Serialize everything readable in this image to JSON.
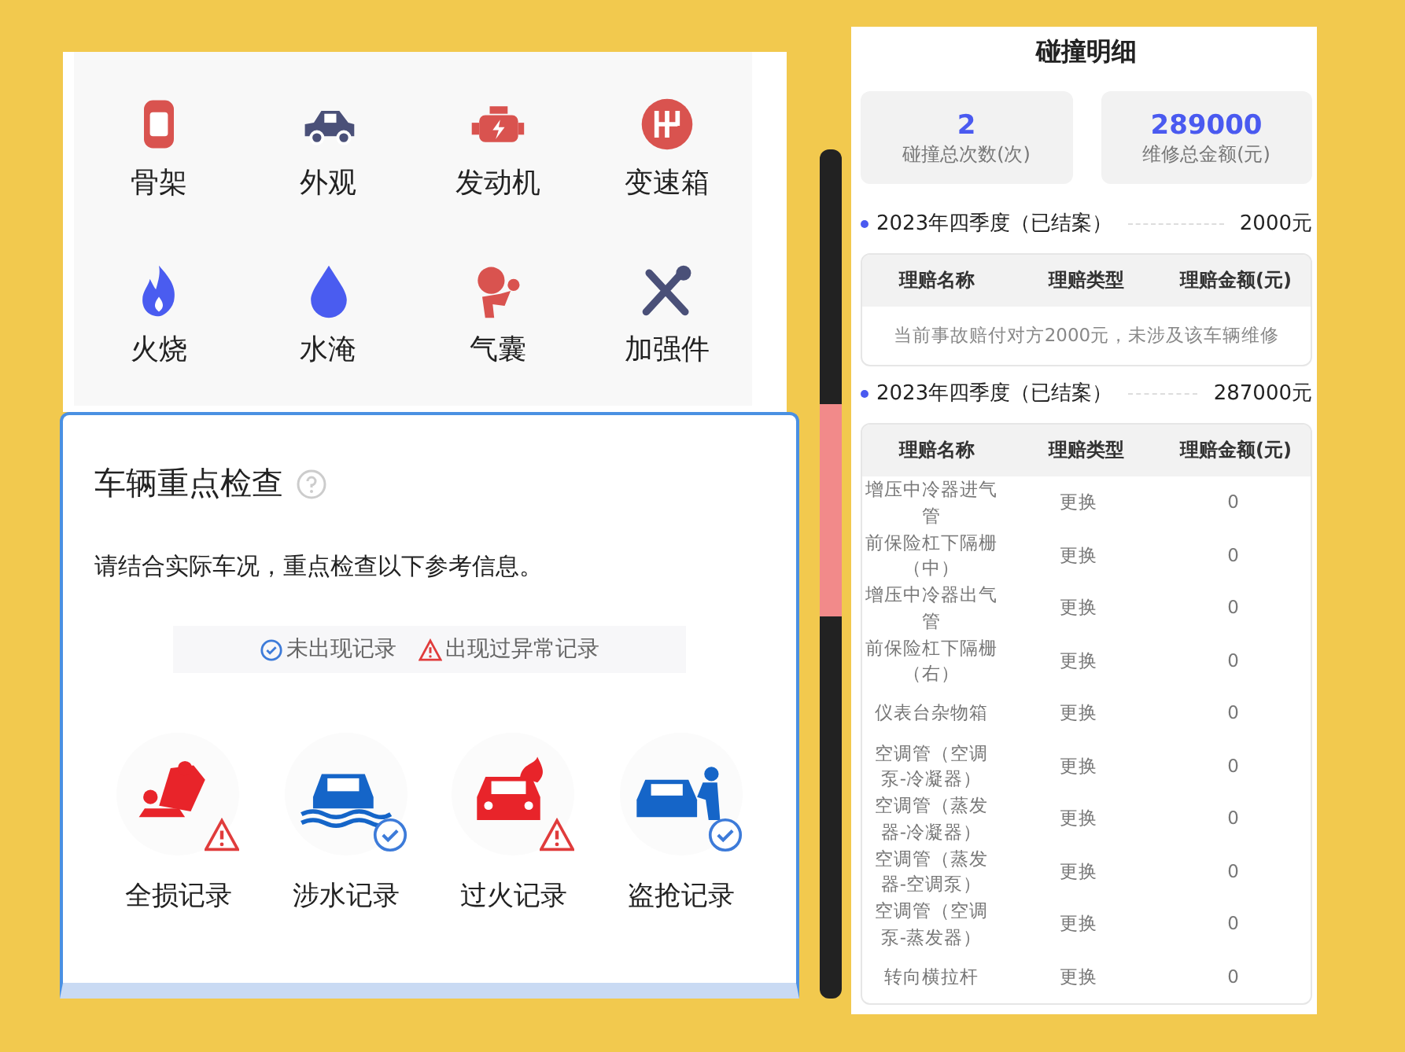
{
  "parts_panel": {
    "items": [
      {
        "label": "骨架"
      },
      {
        "label": "外观"
      },
      {
        "label": "发动机"
      },
      {
        "label": "变速箱"
      },
      {
        "label": "火烧"
      },
      {
        "label": "水淹"
      },
      {
        "label": "气囊"
      },
      {
        "label": "加强件"
      }
    ]
  },
  "inspection": {
    "title": "车辆重点检查",
    "description": "请结合实际车况，重点检查以下参考信息。",
    "legend": [
      {
        "kind": "normal",
        "label": "未出现记录"
      },
      {
        "kind": "abnormal",
        "label": "出现过异常记录"
      }
    ],
    "records": [
      {
        "label": "全损记录",
        "abnormal": true
      },
      {
        "label": "涉水记录",
        "abnormal": false
      },
      {
        "label": "过火记录",
        "abnormal": true
      },
      {
        "label": "盗抢记录",
        "abnormal": false
      }
    ]
  },
  "collision": {
    "title": "碰撞明细",
    "stats": [
      {
        "value": "2",
        "label": "碰撞总次数(次)"
      },
      {
        "value": "289000",
        "label": "维修总金额(元)"
      }
    ],
    "claims": [
      {
        "period": "2023年四季度（已结案）",
        "amount": "2000元",
        "columns": [
          "理赔名称",
          "理赔类型",
          "理赔金额(元)"
        ],
        "note": "当前事故赔付对方2000元，未涉及该车辆维修"
      },
      {
        "period": "2023年四季度（已结案）",
        "amount": "287000元",
        "columns": [
          "理赔名称",
          "理赔类型",
          "理赔金额(元)"
        ],
        "rows": [
          [
            "增压中冷器进气管",
            "更换",
            "0"
          ],
          [
            "前保险杠下隔栅（中）",
            "更换",
            "0"
          ],
          [
            "增压中冷器出气管",
            "更换",
            "0"
          ],
          [
            "前保险杠下隔栅（右）",
            "更换",
            "0"
          ],
          [
            "仪表台杂物箱",
            "更换",
            "0"
          ],
          [
            "空调管（空调泵-冷凝器）",
            "更换",
            "0"
          ],
          [
            "空调管（蒸发器-冷凝器）",
            "更换",
            "0"
          ],
          [
            "空调管（蒸发器-空调泵）",
            "更换",
            "0"
          ],
          [
            "空调管（空调泵-蒸发器）",
            "更换",
            "0"
          ],
          [
            "转向横拉杆",
            "更换",
            "0"
          ]
        ]
      }
    ]
  }
}
